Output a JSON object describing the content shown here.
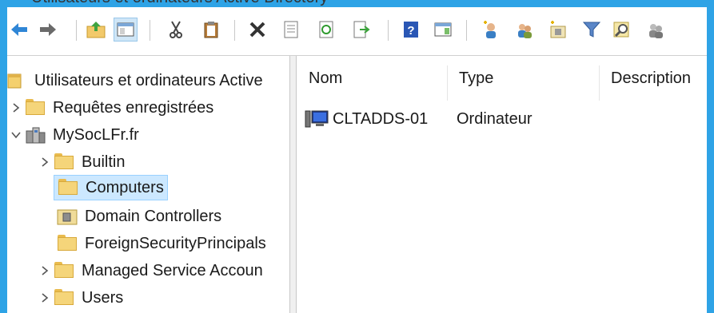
{
  "window": {
    "title_fragment": "Utilisateurs et ordinateurs Active Directory"
  },
  "toolbar": {
    "buttons": [
      {
        "name": "back-button",
        "icon": "arrow-left-icon"
      },
      {
        "name": "forward-button",
        "icon": "arrow-right-icon"
      },
      {
        "name": "up-level-button",
        "icon": "folder-up-icon"
      },
      {
        "name": "show-hide-console-tree-button",
        "icon": "console-tree-icon"
      },
      {
        "name": "cut-button",
        "icon": "scissors-icon"
      },
      {
        "name": "copy-button",
        "icon": "clipboard-icon"
      },
      {
        "name": "delete-button",
        "icon": "delete-x-icon"
      },
      {
        "name": "properties-button",
        "icon": "properties-icon"
      },
      {
        "name": "refresh-button",
        "icon": "refresh-icon"
      },
      {
        "name": "export-list-button",
        "icon": "export-icon"
      },
      {
        "name": "help-button",
        "icon": "help-icon"
      },
      {
        "name": "show-action-pane-button",
        "icon": "action-pane-icon"
      },
      {
        "name": "new-user-button",
        "icon": "new-user-icon"
      },
      {
        "name": "new-group-button",
        "icon": "new-group-icon"
      },
      {
        "name": "new-ou-button",
        "icon": "new-ou-icon"
      },
      {
        "name": "filter-button",
        "icon": "filter-icon"
      },
      {
        "name": "find-button",
        "icon": "find-icon"
      },
      {
        "name": "add-to-group-button",
        "icon": "add-to-group-icon"
      }
    ]
  },
  "tree": {
    "root": "Utilisateurs et ordinateurs Active",
    "items": [
      {
        "label": "Requêtes enregistrées"
      },
      {
        "label": "MySocLFr.fr"
      },
      {
        "label": "Builtin"
      },
      {
        "label": "Computers"
      },
      {
        "label": "Domain Controllers"
      },
      {
        "label": "ForeignSecurityPrincipals"
      },
      {
        "label": "Managed Service Accoun"
      },
      {
        "label": "Users"
      }
    ]
  },
  "list": {
    "columns": [
      "Nom",
      "Type",
      "Description"
    ],
    "rows": [
      {
        "name": "CLTADDS-01",
        "type": "Ordinateur",
        "description": ""
      }
    ]
  },
  "colors": {
    "accent_border": "#2ea3e6",
    "selection": "#cce8ff",
    "folder": "#f5d57a"
  }
}
